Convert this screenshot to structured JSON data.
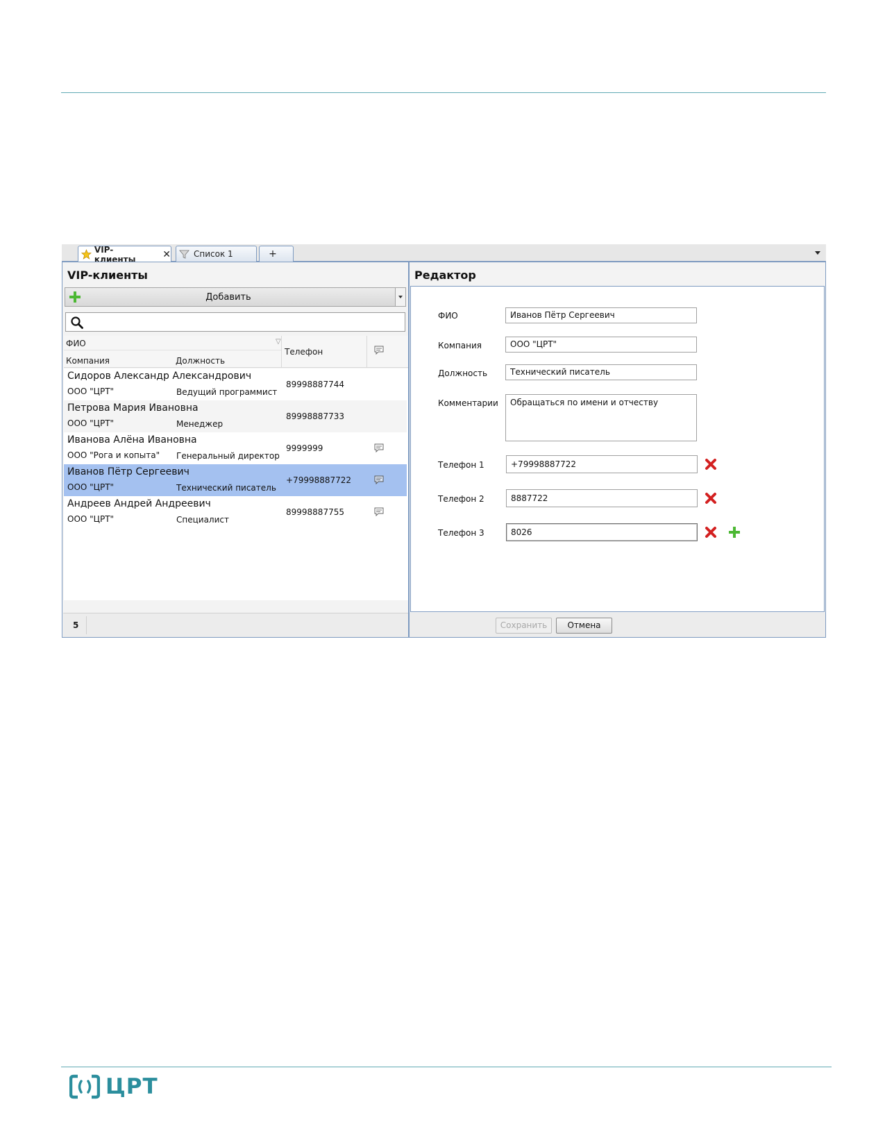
{
  "tabs": [
    {
      "label": "VIP-клиенты",
      "active": true
    },
    {
      "label": "Список 1",
      "active": false
    },
    {
      "label": "+"
    }
  ],
  "left_panel": {
    "title": "VIP-клиенты",
    "add_label": "Добавить",
    "search_placeholder": "",
    "columns": {
      "fio": "ФИО",
      "company": "Компания",
      "position": "Должность",
      "phone": "Телефон"
    },
    "rows": [
      {
        "name": "Сидоров Александр Александрович",
        "company": "ООО \"ЦРТ\"",
        "position": "Ведущий программист",
        "phone": "89998887744",
        "has_comment": false
      },
      {
        "name": "Петрова Мария Ивановна",
        "company": "ООО \"ЦРТ\"",
        "position": "Менеджер",
        "phone": "89998887733",
        "has_comment": false
      },
      {
        "name": "Иванова Алёна Ивановна",
        "company": "ООО \"Рога и копыта\"",
        "position": "Генеральный директор",
        "phone": "9999999",
        "has_comment": true
      },
      {
        "name": "Иванов Пётр Сергеевич",
        "company": "ООО \"ЦРТ\"",
        "position": "Технический писатель",
        "phone": "+79998887722",
        "has_comment": true,
        "selected": true
      },
      {
        "name": "Андреев Андрей Андреевич",
        "company": "ООО \"ЦРТ\"",
        "position": "Специалист",
        "phone": "89998887755",
        "has_comment": true
      }
    ],
    "count": "5"
  },
  "editor": {
    "title": "Редактор",
    "fields": {
      "fio_label": "ФИО",
      "fio_value": "Иванов Пётр Сергеевич",
      "company_label": "Компания",
      "company_value": "ООО \"ЦРТ\"",
      "position_label": "Должность",
      "position_value": "Технический писатель",
      "comment_label": "Комментарии",
      "comment_value": "Обращаться по имени и отчеству"
    },
    "phones": [
      {
        "label": "Телефон 1",
        "value": "+79998887722"
      },
      {
        "label": "Телефон 2",
        "value": "8887722"
      },
      {
        "label": "Телефон 3",
        "value": "8026"
      }
    ],
    "save_label": "Сохранить",
    "cancel_label": "Отмена"
  },
  "logo_text": "ЦРТ",
  "colors": {
    "brand": "#2b8e9d",
    "selected_row": "#a4c1f0",
    "panel_border": "#7d9ac0",
    "delete_icon": "#d32020",
    "add_icon": "#4cb833"
  }
}
